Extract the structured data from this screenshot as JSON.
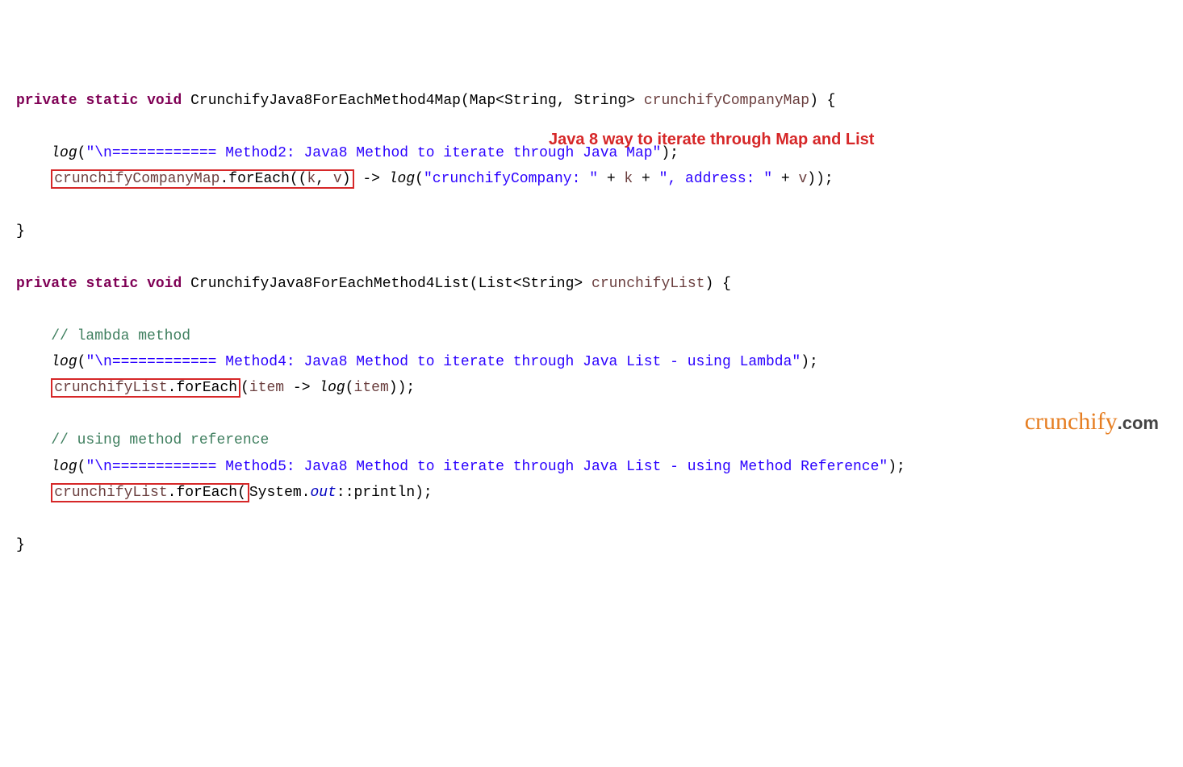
{
  "code": {
    "m1_sig_kw1": "private",
    "m1_sig_kw2": "static",
    "m1_sig_kw3": "void",
    "m1_name": "CrunchifyJava8ForEachMethod4Map",
    "m1_paramtype1": "Map",
    "m1_gen_open": "<",
    "m1_gen_t1": "String",
    "m1_gen_sep": ", ",
    "m1_gen_t2": "String",
    "m1_gen_close": ">",
    "m1_paramname": "crunchifyCompanyMap",
    "m1_sig_tail": ") {",
    "log_fn": "log",
    "m1_log1_str": "\"\\n============ Method2: Java8 Method to iterate through Java Map\"",
    "m1_log1_tail": ");",
    "m1_boxed1": "crunchifyCompanyMap",
    "m1_dot": ".",
    "m1_boxed2a": "forEach((",
    "m1_boxed2b": "k",
    "m1_boxed2c": ", ",
    "m1_boxed2d": "v",
    "m1_boxed2e": ")",
    "m1_arrow": " -> ",
    "m1_log2_str1": "\"crunchifyCompany: \"",
    "m1_plus1": " + ",
    "m1_k": "k",
    "m1_plus2": " + ",
    "m1_log2_str2": "\", address: \"",
    "m1_plus3": " + ",
    "m1_v": "v",
    "m1_log2_tail": "));",
    "m1_close": "}",
    "m2_sig_kw1": "private",
    "m2_sig_kw2": "static",
    "m2_sig_kw3": "void",
    "m2_name": "CrunchifyJava8ForEachMethod4List",
    "m2_paramtype1": "List",
    "m2_gen_open": "<",
    "m2_gen_t1": "String",
    "m2_gen_close": ">",
    "m2_paramname": "crunchifyList",
    "m2_sig_tail": ") {",
    "cmt1": "// lambda method",
    "m2_log1_str": "\"\\n============ Method4: Java8 Method to iterate through Java List - using Lambda\"",
    "m2_log1_tail": ");",
    "m2_boxed1": "crunchifyList",
    "m2_boxed1b": ".forEach",
    "m2_lambda_open": "(",
    "m2_lambda_p": "item",
    "m2_lambda_arrow": " -> ",
    "m2_lambda_call_p": "item",
    "m2_lambda_tail": "));",
    "cmt2": "// using method reference",
    "m2_log2_str": "\"\\n============ Method5: Java8 Method to iterate through Java List - using Method Reference\"",
    "m2_log2_tail": ");",
    "m2_boxed2": "crunchifyList",
    "m2_boxed2b": ".forEach(",
    "m2_sys": "System.",
    "m2_out": "out",
    "m2_ref": "::println);",
    "m2_close": "}"
  },
  "annotation": "Java 8 way to iterate through Map and List",
  "logo": {
    "brand": "crunchify",
    "tld": ".com"
  }
}
